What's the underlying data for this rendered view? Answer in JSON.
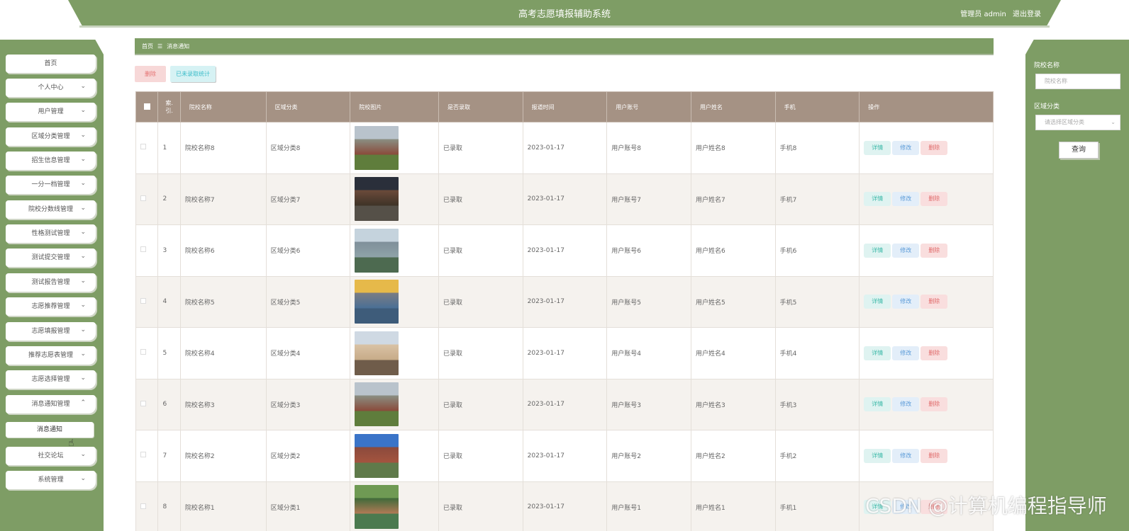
{
  "header": {
    "title": "高考志愿填报辅助系统",
    "role_user": "管理员 admin",
    "logout": "退出登录"
  },
  "sidebar": {
    "items": [
      {
        "label": "首页",
        "has_chevron": false
      },
      {
        "label": "个人中心",
        "has_chevron": true
      },
      {
        "label": "用户管理",
        "has_chevron": true
      },
      {
        "label": "区域分类管理",
        "has_chevron": true
      },
      {
        "label": "招生信息管理",
        "has_chevron": true
      },
      {
        "label": "一分一档管理",
        "has_chevron": true
      },
      {
        "label": "院校分数线管理",
        "has_chevron": true
      },
      {
        "label": "性格测试管理",
        "has_chevron": true
      },
      {
        "label": "测试提交管理",
        "has_chevron": true
      },
      {
        "label": "测试报告管理",
        "has_chevron": true
      },
      {
        "label": "志愿推荐管理",
        "has_chevron": true
      },
      {
        "label": "志愿填报管理",
        "has_chevron": true
      },
      {
        "label": "推荐志愿表管理",
        "has_chevron": true
      },
      {
        "label": "志愿选择管理",
        "has_chevron": true
      },
      {
        "label": "消息通知管理",
        "has_chevron": true,
        "expanded": true
      },
      {
        "label": "消息通知",
        "sub": true,
        "active": true
      },
      {
        "label": "社交论坛",
        "has_chevron": true
      },
      {
        "label": "系统管理",
        "has_chevron": true
      }
    ]
  },
  "breadcrumb": {
    "home": "首页",
    "separator": "☰",
    "current": "消息通知"
  },
  "toolbar": {
    "delete_label": "删除",
    "stat_label": "已未录取统计"
  },
  "table": {
    "headers": [
      "索引",
      "院校名称",
      "区域分类",
      "院校图片",
      "是否录取",
      "报道时间",
      "用户账号",
      "用户姓名",
      "手机",
      "操作"
    ],
    "index_header_top": "索.",
    "index_header_bottom": "引.",
    "rows": [
      {
        "index": "1",
        "name": "院校名称8",
        "region": "区域分类8",
        "admitted": "已录取",
        "time": "2023-01-17",
        "account": "用户账号8",
        "username": "用户姓名8",
        "phone": "手机8"
      },
      {
        "index": "2",
        "name": "院校名称7",
        "region": "区域分类7",
        "admitted": "已录取",
        "time": "2023-01-17",
        "account": "用户账号7",
        "username": "用户姓名7",
        "phone": "手机7"
      },
      {
        "index": "3",
        "name": "院校名称6",
        "region": "区域分类6",
        "admitted": "已录取",
        "time": "2023-01-17",
        "account": "用户账号6",
        "username": "用户姓名6",
        "phone": "手机6"
      },
      {
        "index": "4",
        "name": "院校名称5",
        "region": "区域分类5",
        "admitted": "已录取",
        "time": "2023-01-17",
        "account": "用户账号5",
        "username": "用户姓名5",
        "phone": "手机5"
      },
      {
        "index": "5",
        "name": "院校名称4",
        "region": "区域分类4",
        "admitted": "已录取",
        "time": "2023-01-17",
        "account": "用户账号4",
        "username": "用户姓名4",
        "phone": "手机4"
      },
      {
        "index": "6",
        "name": "院校名称3",
        "region": "区域分类3",
        "admitted": "已录取",
        "time": "2023-01-17",
        "account": "用户账号3",
        "username": "用户姓名3",
        "phone": "手机3"
      },
      {
        "index": "7",
        "name": "院校名称2",
        "region": "区域分类2",
        "admitted": "已录取",
        "time": "2023-01-17",
        "account": "用户账号2",
        "username": "用户姓名2",
        "phone": "手机2"
      },
      {
        "index": "8",
        "name": "院校名称1",
        "region": "区域分类1",
        "admitted": "已录取",
        "time": "2023-01-17",
        "account": "用户账号1",
        "username": "用户姓名1",
        "phone": "手机1"
      }
    ],
    "actions": {
      "detail": "详情",
      "edit": "修改",
      "delete": "删除"
    }
  },
  "search": {
    "name_label": "院校名称",
    "name_placeholder": "院校名称",
    "region_label": "区域分类",
    "region_placeholder": "请选择区域分类",
    "query_button": "查询"
  },
  "watermark": "CSDN @计算机编程指导师",
  "colors": {
    "primary": "#7e9d65",
    "table_header": "#a59284",
    "delete": "#e06b6b",
    "detail": "#3ab8a7",
    "edit": "#5b9bd8"
  }
}
